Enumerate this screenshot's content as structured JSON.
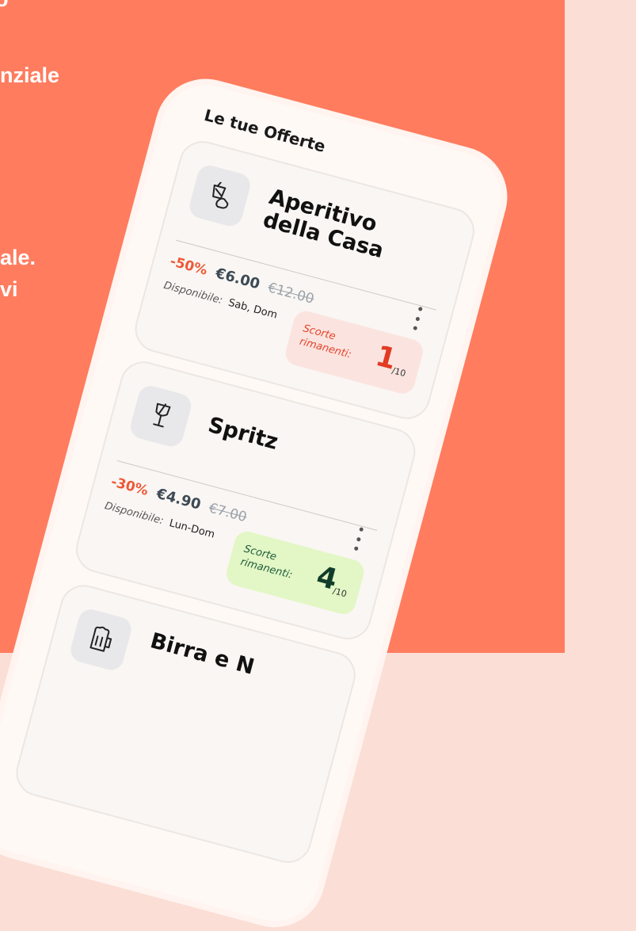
{
  "background": {
    "coral": "#ff7c5f",
    "pink": "#fbded6",
    "side_text": [
      "o",
      "nziale",
      "ale.",
      "vi"
    ]
  },
  "phone": {
    "title": "Le tue Offerte",
    "offers": [
      {
        "icon": "cocktail-hand-icon",
        "title": "Aperitivo della Casa",
        "discount": "-50%",
        "price": "€6.00",
        "old_price": "€12.00",
        "available_label": "Disponibile:",
        "available_days": "Sab, Dom",
        "stock_label": "Scorte\nrimanenti:",
        "stock_count": "1",
        "stock_total": "/10",
        "stock_color": "#fbe4df"
      },
      {
        "icon": "wine-glass-icon",
        "title": "Spritz",
        "discount": "-30%",
        "price": "€4.90",
        "old_price": "€7.00",
        "available_label": "Disponibile:",
        "available_days": "Lun-Dom",
        "stock_label": "Scorte\nrimanenti:",
        "stock_count": "4",
        "stock_total": "/10",
        "stock_color": "#e2f7c5"
      },
      {
        "icon": "beer-mug-icon",
        "title": "Birra e N"
      }
    ]
  }
}
